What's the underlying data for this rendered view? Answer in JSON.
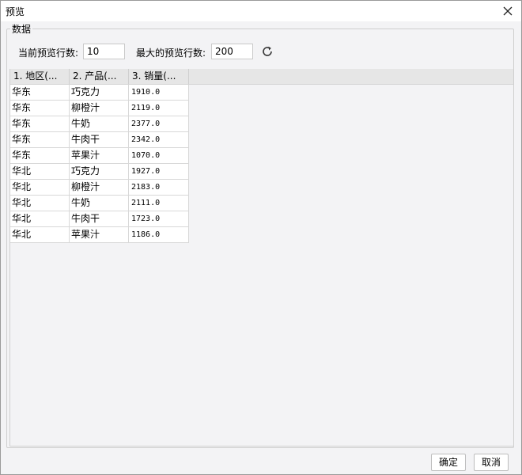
{
  "window": {
    "title": "预览"
  },
  "group": {
    "legend": "数据"
  },
  "controls": {
    "current_rows_label": "当前预览行数:",
    "current_rows_value": "10",
    "max_rows_label": "最大的预览行数:",
    "max_rows_value": "200"
  },
  "table": {
    "columns": [
      "1. 地区(...",
      "2. 产品(...",
      "3. 销量(..."
    ],
    "rows": [
      [
        "华东",
        "巧克力",
        "1910.0"
      ],
      [
        "华东",
        "柳橙汁",
        "2119.0"
      ],
      [
        "华东",
        "牛奶",
        "2377.0"
      ],
      [
        "华东",
        "牛肉干",
        "2342.0"
      ],
      [
        "华东",
        "苹果汁",
        "1070.0"
      ],
      [
        "华北",
        "巧克力",
        "1927.0"
      ],
      [
        "华北",
        "柳橙汁",
        "2183.0"
      ],
      [
        "华北",
        "牛奶",
        "2111.0"
      ],
      [
        "华北",
        "牛肉干",
        "1723.0"
      ],
      [
        "华北",
        "苹果汁",
        "1186.0"
      ]
    ]
  },
  "footer": {
    "ok_label": "确定",
    "cancel_label": "取消"
  },
  "icons": {
    "close": "close-icon",
    "refresh": "refresh-icon"
  }
}
